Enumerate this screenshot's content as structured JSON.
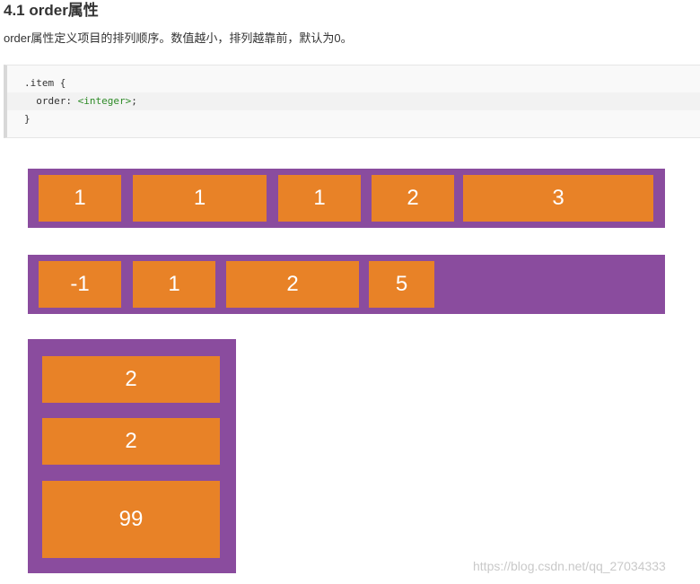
{
  "heading": "4.1 order属性",
  "description": "order属性定义项目的排列顺序。数值越小，排列越靠前，默认为0。",
  "code": {
    "line1": ".item {",
    "line2_prop": "  order: ",
    "line2_value": "<integer>",
    "line2_end": ";",
    "line3": "}"
  },
  "row1": {
    "items": [
      "1",
      "1",
      "1",
      "2",
      "3"
    ]
  },
  "row2": {
    "items": [
      "-1",
      "1",
      "2",
      "5"
    ]
  },
  "column": {
    "items": [
      "2",
      "2",
      "99"
    ]
  },
  "watermark": "https://blog.csdn.net/qq_27034333",
  "colors": {
    "container": "#8a4c9e",
    "item": "#e88227",
    "item_text": "#ffffff"
  }
}
